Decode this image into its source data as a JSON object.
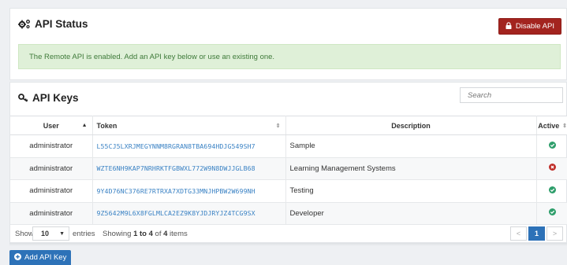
{
  "status_panel": {
    "title": "API Status",
    "title_icon": "gears-icon",
    "disable_button": {
      "label": "Disable API",
      "icon": "lock-icon"
    },
    "alert": "The Remote API is enabled. Add an API key below or use an existing one."
  },
  "keys_panel": {
    "title": "API Keys",
    "title_icon": "key-icon",
    "search_placeholder": "Search",
    "columns": [
      "User",
      "Token",
      "Description",
      "Active"
    ],
    "rows": [
      {
        "user": "administrator",
        "token": "L55CJ5LXRJMEGYNNM8RGRAN8TBA694HDJG549SH7",
        "description": "Sample",
        "active": true
      },
      {
        "user": "administrator",
        "token": "WZTE6NH9KAP7NRHRKTFGBWXL772W9N8DWJJGLB68",
        "description": "Learning Management Systems",
        "active": false
      },
      {
        "user": "administrator",
        "token": "9Y4D76NC376RE7RTRXA7XDTG33MNJHPBW2W699NH",
        "description": "Testing",
        "active": true
      },
      {
        "user": "administrator",
        "token": "9Z5642M9L6X8FGLMLCA2EZ9K8YJDJRYJZ4TCG9SX",
        "description": "Developer",
        "active": true
      }
    ],
    "footer": {
      "show": "Show",
      "page_size": "10",
      "entries": "entries",
      "showing_prefix": "Showing ",
      "showing_range": "1 to 4",
      "showing_mid": " of ",
      "showing_total": "4",
      "showing_suffix": " items",
      "prev": "<",
      "page": "1",
      "next": ">"
    }
  },
  "add_button": {
    "label": "Add API Key",
    "icon": "plus-circle-icon"
  },
  "colors": {
    "danger": "#a3241f",
    "primary": "#2d72b8",
    "success": "#2e9e6b",
    "error": "#c0302b",
    "alert_bg": "#dff0d8"
  }
}
